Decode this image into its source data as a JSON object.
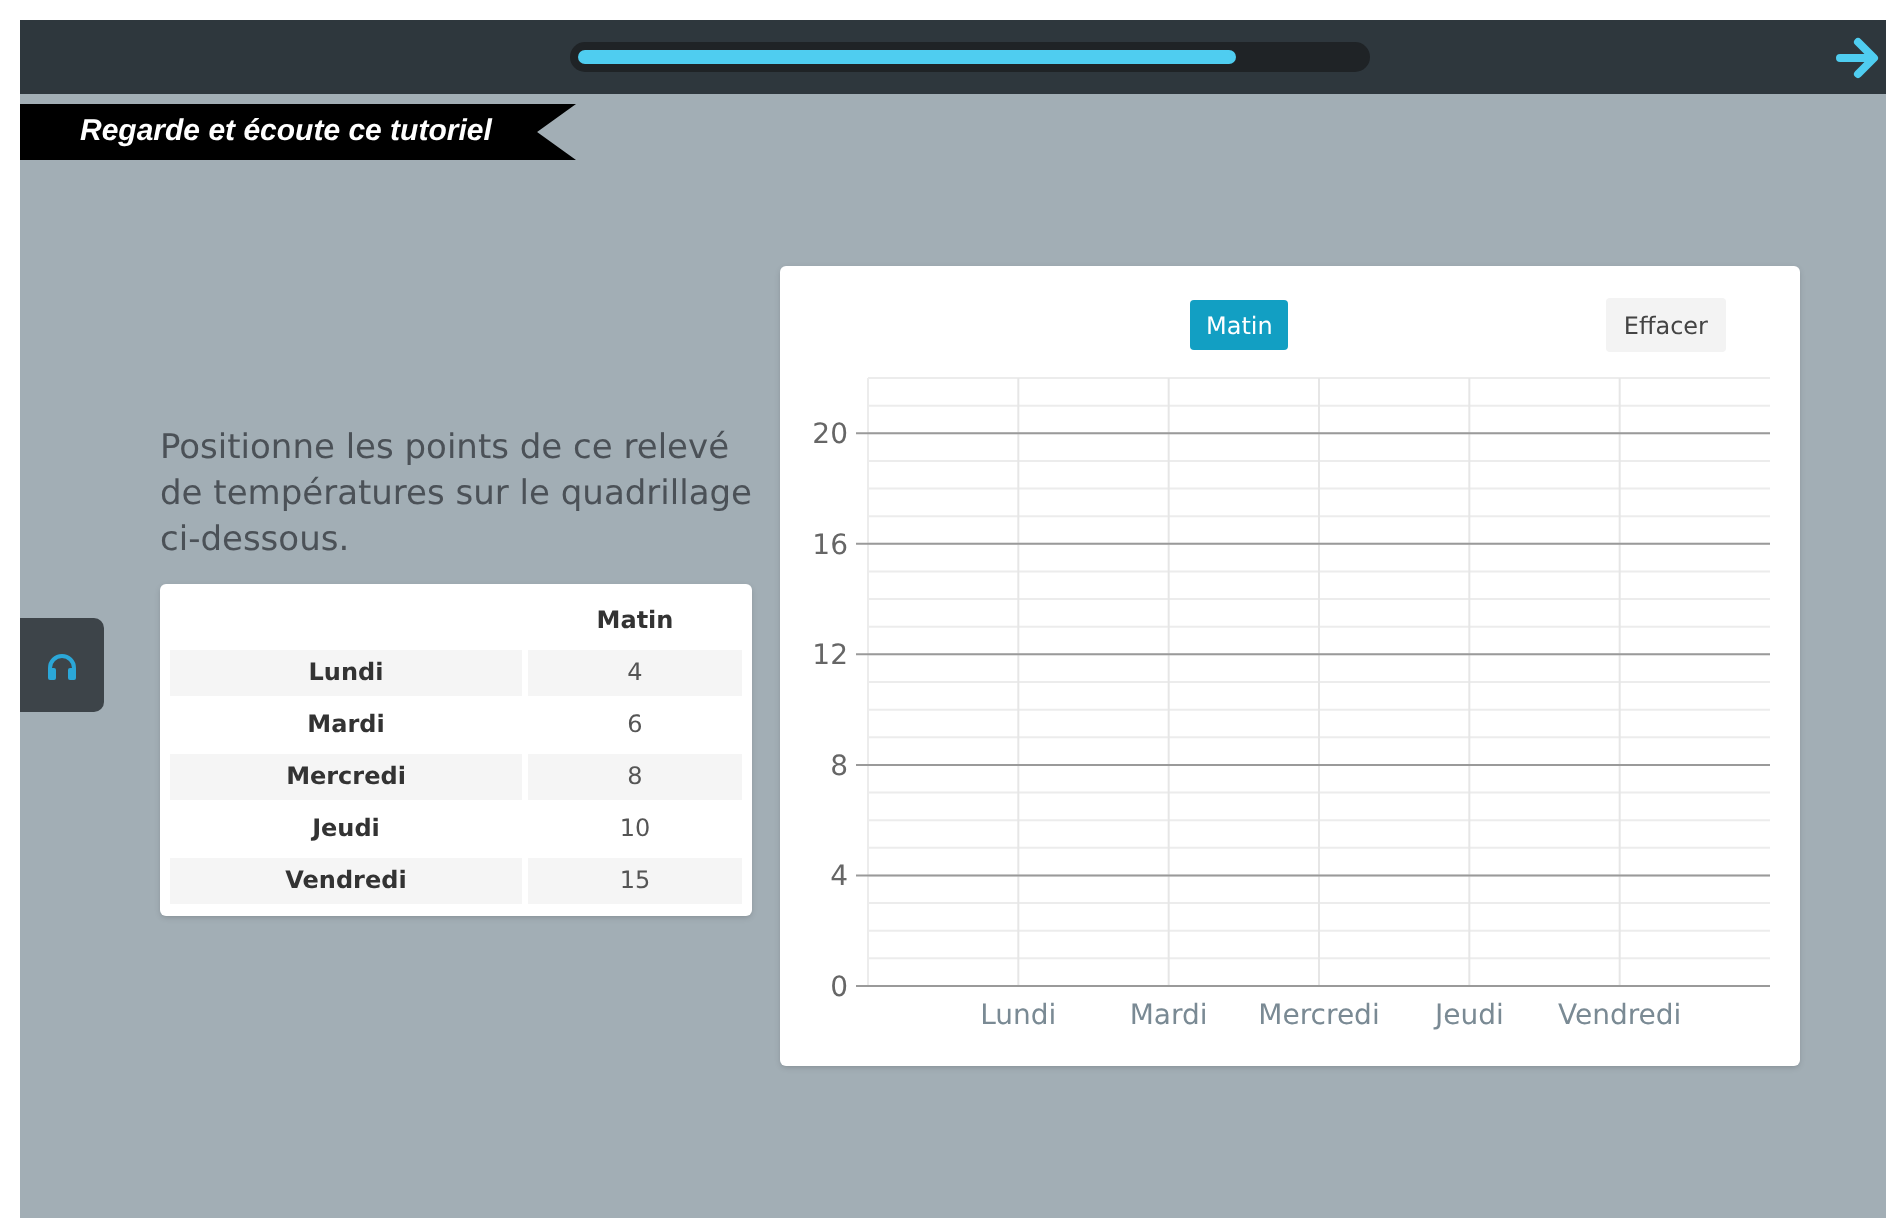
{
  "top_bar": {
    "progress": {
      "level": 0.84
    }
  },
  "banner": {
    "title": "Regarde et écoute ce tutoriel"
  },
  "instruction": "Positionne les points de ce relevé de températures sur le quadrillage ci-dessous.",
  "table": {
    "columns": [
      "",
      "Matin"
    ],
    "rows": [
      {
        "day": "Lundi",
        "value": "4"
      },
      {
        "day": "Mardi",
        "value": "6"
      },
      {
        "day": "Mercredi",
        "value": "8"
      },
      {
        "day": "Jeudi",
        "value": "10"
      },
      {
        "day": "Vendredi",
        "value": "15"
      }
    ]
  },
  "chart_panel": {
    "series_buttons": [
      {
        "label": "Matin",
        "selected": true
      }
    ],
    "clear_button": "Effacer",
    "chart_data": {
      "type": "scatter",
      "categories": [
        "Lundi",
        "Mardi",
        "Mercredi",
        "Jeudi",
        "Vendredi"
      ],
      "grid": true,
      "ylim": [
        0,
        22
      ],
      "yticks": [
        0,
        4,
        8,
        12,
        16,
        20
      ]
    }
  }
}
